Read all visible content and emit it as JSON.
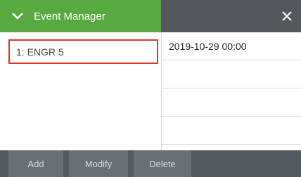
{
  "header": {
    "title": "Event Manager",
    "accent_color": "#58a940",
    "bar_color": "#54585d",
    "expand_icon": "chevron-down-icon",
    "close_icon": "close-icon"
  },
  "events": [
    {
      "label": "1: ENGR 5",
      "selected": true
    }
  ],
  "times": [
    {
      "value": "2019-10-29 00:00"
    },
    {
      "value": ""
    },
    {
      "value": ""
    },
    {
      "value": ""
    }
  ],
  "footer": {
    "add_label": "Add",
    "modify_label": "Modify",
    "delete_label": "Delete"
  },
  "selection_color": "#e0352b"
}
